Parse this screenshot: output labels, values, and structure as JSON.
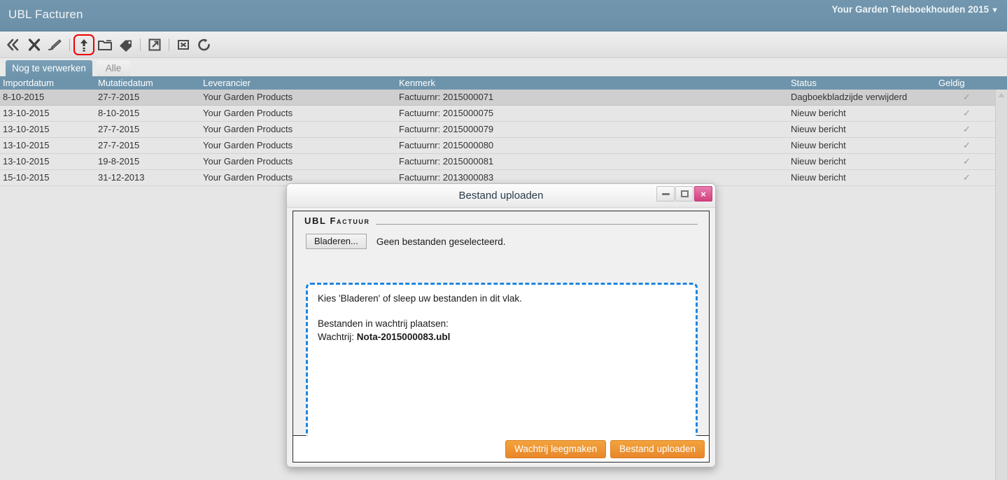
{
  "header": {
    "app_title": "UBL Facturen",
    "company_menu": "Your Garden Teleboekhouden 2015",
    "company_caret": "▼",
    "bg_color": "#6e94ab"
  },
  "toolbar": {
    "items": [
      {
        "icon": "collapse-double-left-icon",
        "label": "Inklappen"
      },
      {
        "icon": "delete-x-icon",
        "label": "Verwijderen"
      },
      {
        "icon": "pencil-edit-icon",
        "label": "Bewerken"
      },
      {
        "icon": "upload-arrow-icon",
        "label": "Bestand uploaden"
      },
      {
        "icon": "folder-open-icon",
        "label": "Map openen"
      },
      {
        "icon": "tag-icon",
        "label": "Label"
      },
      {
        "icon": "open-external-icon",
        "label": "Openen in nieuw venster"
      },
      {
        "icon": "image-placeholder-icon",
        "label": "Afbeelding"
      },
      {
        "icon": "refresh-icon",
        "label": "Vernieuwen"
      }
    ],
    "highlight_color": "#f00000"
  },
  "tabs": [
    {
      "label": "Nog te verwerken",
      "active": true
    },
    {
      "label": "Alle",
      "active": false
    }
  ],
  "grid": {
    "columns": [
      {
        "key": "importdatum",
        "label": "Importdatum"
      },
      {
        "key": "mutatiedatum",
        "label": "Mutatiedatum"
      },
      {
        "key": "leverancier",
        "label": "Leverancier"
      },
      {
        "key": "kenmerk",
        "label": "Kenmerk"
      },
      {
        "key": "status",
        "label": "Status"
      },
      {
        "key": "geldig",
        "label": "Geldig"
      }
    ],
    "rows": [
      {
        "importdatum": "8-10-2015",
        "mutatiedatum": "27-7-2015",
        "leverancier": "Your Garden Products",
        "kenmerk": "Factuurnr: 2015000071",
        "status": "Dagboekbladzijde verwijderd",
        "geldig": "✓",
        "selected": true
      },
      {
        "importdatum": "13-10-2015",
        "mutatiedatum": "8-10-2015",
        "leverancier": "Your Garden Products",
        "kenmerk": "Factuurnr: 2015000075",
        "status": "Nieuw bericht",
        "geldig": "✓",
        "selected": false
      },
      {
        "importdatum": "13-10-2015",
        "mutatiedatum": "27-7-2015",
        "leverancier": "Your Garden Products",
        "kenmerk": "Factuurnr: 2015000079",
        "status": "Nieuw bericht",
        "geldig": "✓",
        "selected": false
      },
      {
        "importdatum": "13-10-2015",
        "mutatiedatum": "27-7-2015",
        "leverancier": "Your Garden Products",
        "kenmerk": "Factuurnr: 2015000080",
        "status": "Nieuw bericht",
        "geldig": "✓",
        "selected": false
      },
      {
        "importdatum": "13-10-2015",
        "mutatiedatum": "19-8-2015",
        "leverancier": "Your Garden Products",
        "kenmerk": "Factuurnr: 2015000081",
        "status": "Nieuw bericht",
        "geldig": "✓",
        "selected": false
      },
      {
        "importdatum": "15-10-2015",
        "mutatiedatum": "31-12-2013",
        "leverancier": "Your Garden Products",
        "kenmerk": "Factuurnr: 2013000083",
        "status": "Nieuw bericht",
        "geldig": "✓",
        "selected": false
      }
    ]
  },
  "dialog": {
    "title": "Bestand uploaden",
    "window_buttons": {
      "minimize": "minimize-icon",
      "maximize": "maximize-icon",
      "close": "×"
    },
    "legend": "UBL Factuur",
    "browse_button": "Bladeren...",
    "no_file_selected": "Geen bestanden geselecteerd.",
    "dropzone": {
      "instruction": "Kies 'Bladeren' of sleep uw bestanden in dit vlak.",
      "queue_heading": "Bestanden in wachtrij plaatsen:",
      "queue_label": "Wachtrij:",
      "queue_file": "Nota-2015000083.ubl",
      "border_color": "#1e86e0"
    },
    "footer_buttons": [
      {
        "label": "Wachtrij leegmaken",
        "name": "clear-queue-button"
      },
      {
        "label": "Bestand uploaden",
        "name": "upload-file-button"
      }
    ],
    "accent_color": "#e8872b"
  }
}
